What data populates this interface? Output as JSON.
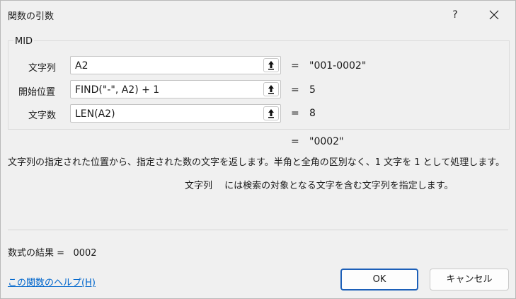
{
  "window": {
    "title": "関数の引数",
    "help_label": "?"
  },
  "function_name": "MID",
  "arguments": [
    {
      "label": "文字列",
      "value": "A2",
      "equals": "=",
      "result": "\"001-0002\""
    },
    {
      "label": "開始位置",
      "value": "FIND(\"-\", A2) + 1",
      "equals": "=",
      "result": "5"
    },
    {
      "label": "文字数",
      "value": "LEN(A2)",
      "equals": "=",
      "result": "8"
    }
  ],
  "overall": {
    "equals": "=",
    "result": "\"0002\""
  },
  "description": "文字列の指定された位置から、指定された数の文字を返します。半角と全角の区別なく、1 文字を 1 として処理します。",
  "param_description": "文字列　 には検索の対象となる文字を含む文字列を指定します。",
  "formula_result": {
    "label": "数式の結果 =",
    "value": "0002"
  },
  "help_link": "この関数のヘルプ(H)",
  "buttons": {
    "ok": "OK",
    "cancel": "キャンセル"
  },
  "icons": {
    "close": "close-icon",
    "reference": "collapse-dialog-icon"
  }
}
